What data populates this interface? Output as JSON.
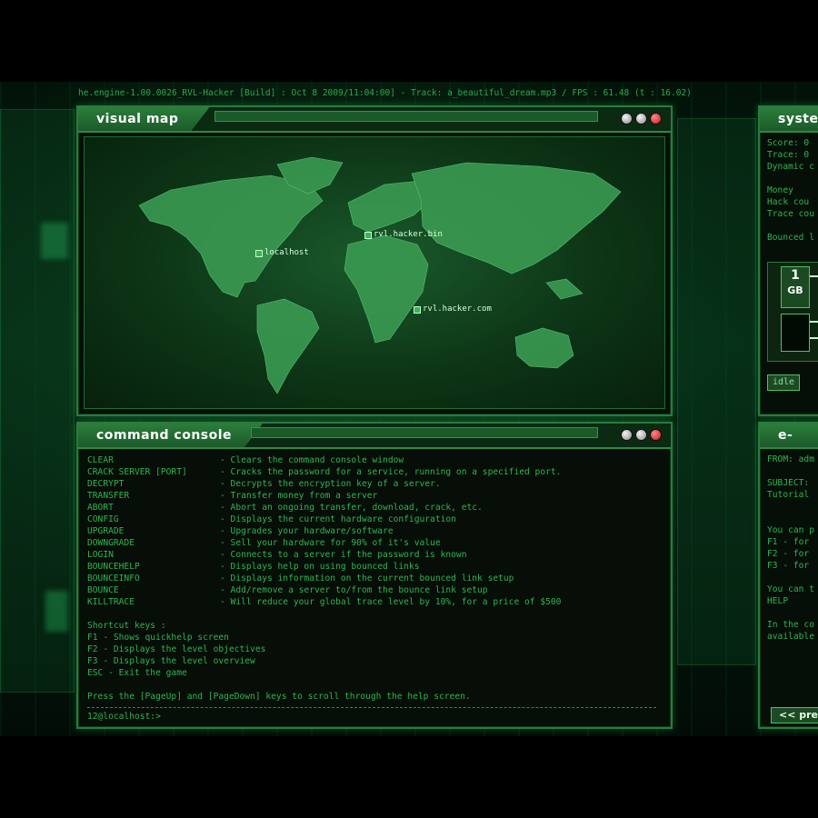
{
  "status_bar": "he.engine-1.00.0026_RVL-Hacker [Build] : Oct  8 2009/11:04:00] - Track: a_beautiful_dream.mp3 / FPS : 61.48 (t : 16.02)",
  "visual_map": {
    "title": "visual map",
    "labels": {
      "localhost": "localhost",
      "rvl_hacker_bin": "rvl.hacker.bin",
      "rvl_hacker_com": "rvl.hacker.com"
    }
  },
  "command_console": {
    "title": "command console",
    "commands": [
      {
        "name": "CLEAR",
        "desc": "- Clears the command console window"
      },
      {
        "name": "CRACK SERVER [PORT]",
        "desc": "- Cracks the password for a service, running on a specified port."
      },
      {
        "name": "DECRYPT",
        "desc": "- Decrypts the encryption key of a server."
      },
      {
        "name": "TRANSFER",
        "desc": "- Transfer money from a server"
      },
      {
        "name": "ABORT",
        "desc": "- Abort an ongoing transfer, download, crack, etc."
      },
      {
        "name": "CONFIG",
        "desc": "- Displays the current hardware configuration"
      },
      {
        "name": "UPGRADE",
        "desc": "- Upgrades your hardware/software"
      },
      {
        "name": "DOWNGRADE",
        "desc": "- Sell your hardware for 90% of it's value"
      },
      {
        "name": "LOGIN",
        "desc": "- Connects to a server if the password is known"
      },
      {
        "name": "BOUNCEHELP",
        "desc": "- Displays help on using bounced links"
      },
      {
        "name": "BOUNCEINFO",
        "desc": "- Displays information on the current bounced link setup"
      },
      {
        "name": "BOUNCE",
        "desc": "- Add/remove a server to/from the bounce link setup"
      },
      {
        "name": "KILLTRACE",
        "desc": "- Will reduce your global trace level by 10%, for a price of $500"
      }
    ],
    "shortcut_header": "Shortcut keys :",
    "shortcuts": [
      "F1  - Shows quickhelp screen",
      "F2  - Displays the level objectives",
      "F3  - Displays the level overview",
      "ESC - Exit the game"
    ],
    "scroll_hint": "Press the [PageUp] and [PageDown] keys to scroll through the help screen.",
    "prompt": "12@localhost:>"
  },
  "system_panel": {
    "title": "syste",
    "lines": [
      "Score: 0",
      "Trace: 0",
      "Dynamic c",
      "",
      "Money",
      "Hack cou",
      "Trace cou",
      "",
      "Bounced l"
    ],
    "ram_size": "1",
    "ram_unit": "GB",
    "status": "idle"
  },
  "email_panel": {
    "title": "e-mai",
    "lines": [
      "FROM: adm",
      "",
      "SUBJECT:",
      "Tutorial",
      "",
      "",
      "You can p",
      "F1 - for",
      "F2 - for",
      "F3 - for",
      "",
      "You can t",
      "HELP",
      "",
      "In the co",
      "available"
    ],
    "prev_button": "<< pre"
  },
  "colors": {
    "accent": "#2fb452",
    "frame": "#2a7a3e",
    "title_text": "#ffffff",
    "close_button": "#c81414"
  }
}
